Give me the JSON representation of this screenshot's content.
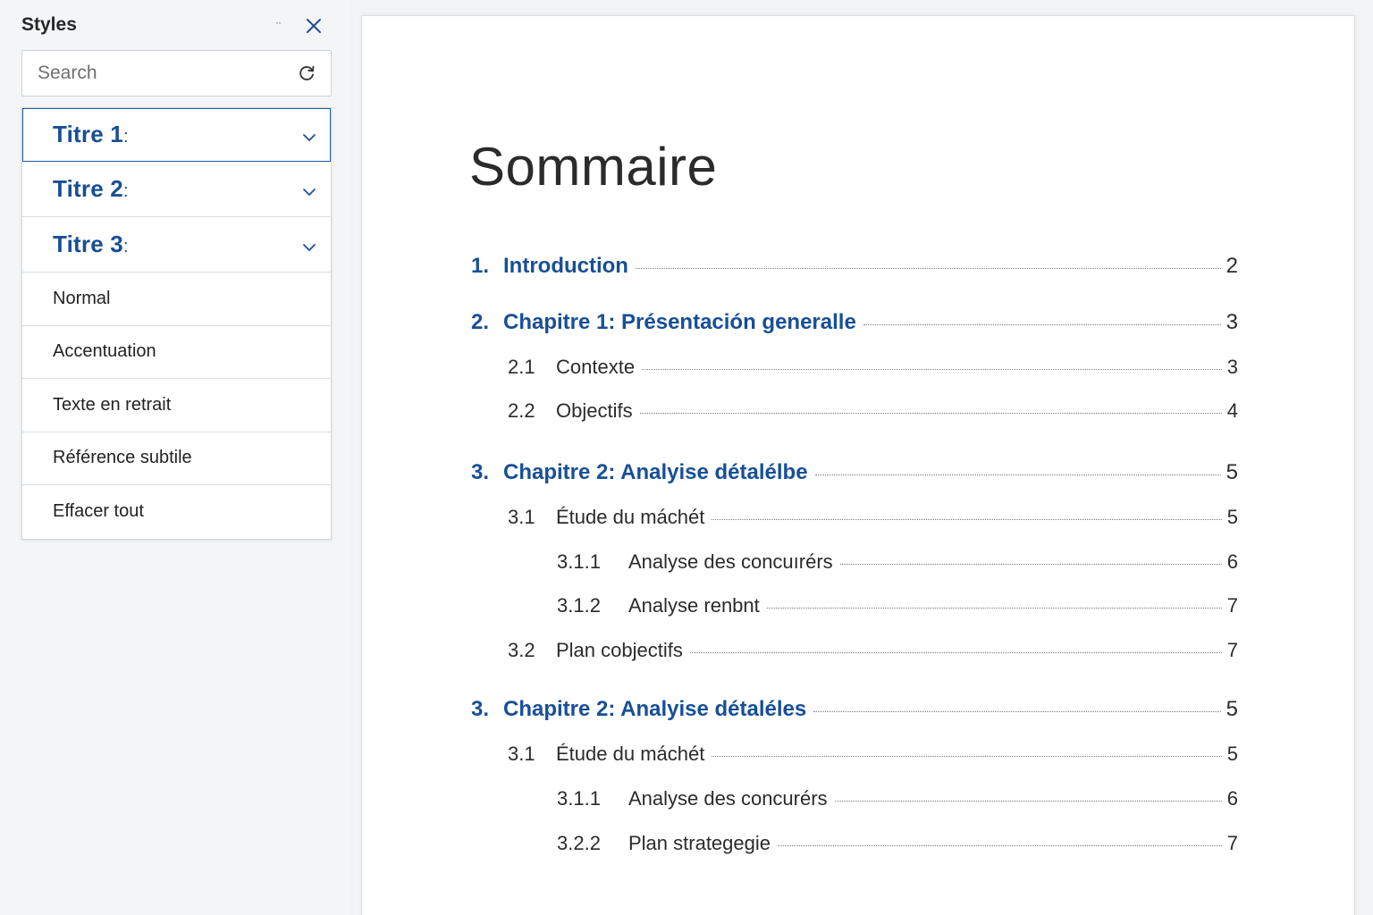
{
  "pane": {
    "title": "Styles",
    "minimize_glyph": "··",
    "close_icon": "close-icon",
    "search": {
      "placeholder": "Search",
      "value": "",
      "icon": "refresh-icon"
    },
    "styles": [
      {
        "label": "Titre 1",
        "suffix": ":",
        "kind": "heading",
        "selected": true
      },
      {
        "label": "Titre 2",
        "suffix": ":",
        "kind": "heading",
        "selected": false
      },
      {
        "label": "Titre 3",
        "suffix": ":",
        "kind": "heading",
        "selected": false
      },
      {
        "label": "Normal",
        "kind": "plain"
      },
      {
        "label": "Accentuation",
        "kind": "plain"
      },
      {
        "label": "Texte en retrait",
        "kind": "plain"
      },
      {
        "label": "Référence subtile",
        "kind": "plain"
      },
      {
        "label": "Effacer tout",
        "kind": "plain"
      }
    ]
  },
  "document": {
    "title": "Sommaire",
    "toc": [
      {
        "level": 1,
        "num": "1.",
        "text": "Introduction",
        "page": "2"
      },
      {
        "level": 1,
        "num": "2.",
        "text": "Chapitre 1: Présentación generalle",
        "page": "3"
      },
      {
        "level": 2,
        "num": "2.1",
        "text": "Contexte",
        "page": "3"
      },
      {
        "level": 2,
        "num": "2.2",
        "text": "Objectifs",
        "page": "4"
      },
      {
        "level": 1,
        "num": "3.",
        "text": "Chapitre 2: Analyise détalélbe",
        "page": "5"
      },
      {
        "level": 2,
        "num": "3.1",
        "text": "Étude du máchét",
        "page": "5"
      },
      {
        "level": 3,
        "num": "3.1.1",
        "text": "Analyse des concuırérs",
        "page": "6"
      },
      {
        "level": 3,
        "num": "3.1.2",
        "text": "Analyse renbnt",
        "page": "7"
      },
      {
        "level": 2,
        "num": "3.2",
        "text": "Plan cobjectifs",
        "page": "7"
      },
      {
        "level": 1,
        "num": "3.",
        "text": "Chapitre 2: Analyise détaléles",
        "page": "5"
      },
      {
        "level": 2,
        "num": "3.1",
        "text": "Étude du máchét",
        "page": "5"
      },
      {
        "level": 3,
        "num": "3.1.1",
        "text": "Analyse des concurérs",
        "page": "6"
      },
      {
        "level": 3,
        "num": "3.2.2",
        "text": "Plan strategegie",
        "page": "7"
      }
    ]
  },
  "colors": {
    "heading": "#174f97",
    "text": "#2b2b2b",
    "pane_bg": "#f4f5f7"
  }
}
